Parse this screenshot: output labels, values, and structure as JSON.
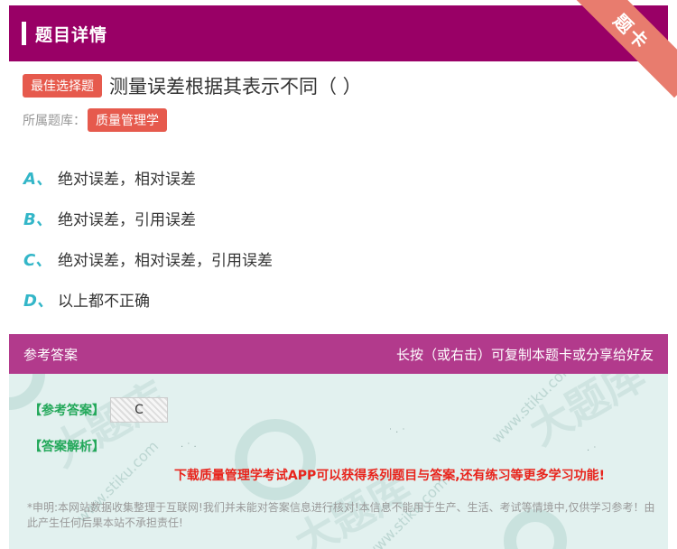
{
  "header": {
    "title": "题目详情"
  },
  "ribbon": {
    "label": "题卡"
  },
  "question": {
    "type_tag": "最佳选择题",
    "text": "测量误差根据其表示不同（ ）",
    "library_label": "所属题库：",
    "library_tag": "质量管理学"
  },
  "options": [
    {
      "letter": "A、",
      "text": "绝对误差，相对误差"
    },
    {
      "letter": "B、",
      "text": "绝对误差，引用误差"
    },
    {
      "letter": "C、",
      "text": "绝对误差，相对误差，引用误差"
    },
    {
      "letter": "D、",
      "text": "以上都不正确"
    }
  ],
  "answer_section": {
    "title": "参考答案",
    "hint": "长按（或右击）可复制本题卡或分享给好友",
    "ref_label": "【参考答案】",
    "ref_value": "C",
    "explain_label": "【答案解析】",
    "promo": "下载质量管理学考试APP可以获得系列题目与答案,还有练习等更多学习功能!",
    "notice": "*申明:本网站数据收集整理于互联网!我们并未能对答案信息进行核对!本信息不能用于生产、生活、考试等情境中,仅供学习参考！由此产生任何后果本站不承担责任!"
  },
  "colors": {
    "header_bg": "#990066",
    "ribbon": "#e87c6e",
    "tag_bg": "#e65a4d",
    "option_letter": "#33b6c8",
    "answer_head_bg": "#b23a8c",
    "answer_body_bg": "#e2f1ef",
    "label_green": "#23a85a",
    "promo_red": "#e8241c"
  }
}
